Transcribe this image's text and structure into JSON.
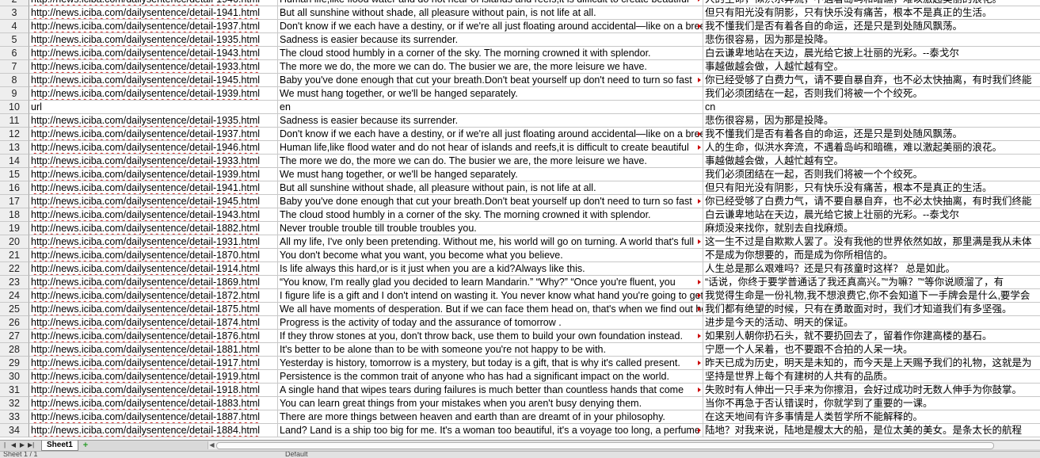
{
  "rows": [
    {
      "num": "2",
      "url": "http://news.iciba.com/dailysentence/detail-1946.html",
      "en": "Human life,like flood water and do not hear of islands and reefs,it is difficult to create beautiful",
      "cn": "人的生命，似洪水奔流，不遇着岛屿和暗礁，难以激起美丽的浪花。"
    },
    {
      "num": "3",
      "url": "http://news.iciba.com/dailysentence/detail-1941.html",
      "en": "But all sunshine without shade, all pleasure without pain, is not life at all.",
      "cn": "但只有阳光没有阴影，只有快乐没有痛苦，根本不是真正的生活。"
    },
    {
      "num": "4",
      "url": "http://news.iciba.com/dailysentence/detail-1937.html",
      "en": "Don't know if we each have a destiny, or if we're all just floating around accidental—like on a breeze",
      "cn": "我不懂我们是否有着各自的命运，还是只是到处随风飘荡。"
    },
    {
      "num": "5",
      "url": "http://news.iciba.com/dailysentence/detail-1935.html",
      "en": "Sadness is easier because its surrender.",
      "cn": "悲伤很容易，因为那是投降。"
    },
    {
      "num": "6",
      "url": "http://news.iciba.com/dailysentence/detail-1943.html",
      "en": "The cloud stood humbly in a corner of the sky. The morning crowned it with splendor.",
      "cn": "白云谦卑地站在天边，晨光给它披上壮丽的光彩。--泰戈尔"
    },
    {
      "num": "7",
      "url": "http://news.iciba.com/dailysentence/detail-1933.html",
      "en": "The more we do, the more we can do. The busier we are, the more leisure we have.",
      "cn": "事越做越会做，人越忙越有空。"
    },
    {
      "num": "8",
      "url": "http://news.iciba.com/dailysentence/detail-1945.html",
      "en": "Baby you've done enough that cut your breath.Don't beat yourself up don't need to turn so fast",
      "cn": "你已经受够了白费力气，请不要自暴自弃，也不必太快抽离，有时我们终能"
    },
    {
      "num": "9",
      "url": "http://news.iciba.com/dailysentence/detail-1939.html",
      "en": " We must hang together, or we'll be hanged separately.",
      "cn": "我们必须团结在一起，否则我们将被一个个绞死。"
    },
    {
      "num": "10",
      "url": "url",
      "en": "en",
      "cn": "cn"
    },
    {
      "num": "11",
      "url": "http://news.iciba.com/dailysentence/detail-1935.html",
      "en": "Sadness is easier because its surrender.",
      "cn": "悲伤很容易，因为那是投降。"
    },
    {
      "num": "12",
      "url": "http://news.iciba.com/dailysentence/detail-1937.html",
      "en": "Don't know if we each have a destiny, or if we're all just floating around accidental—like on a breeze",
      "cn": "我不懂我们是否有着各自的命运，还是只是到处随风飘荡。"
    },
    {
      "num": "13",
      "url": "http://news.iciba.com/dailysentence/detail-1946.html",
      "en": "Human life,like flood water and do not hear of islands and reefs,it is difficult to create beautiful",
      "cn": "人的生命，似洪水奔流，不遇着岛屿和暗礁，难以激起美丽的浪花。"
    },
    {
      "num": "14",
      "url": "http://news.iciba.com/dailysentence/detail-1933.html",
      "en": "The more we do, the more we can do. The busier we are, the more leisure we have.",
      "cn": "事越做越会做，人越忙越有空。"
    },
    {
      "num": "15",
      "url": "http://news.iciba.com/dailysentence/detail-1939.html",
      "en": " We must hang together, or we'll be hanged separately.",
      "cn": "我们必须团结在一起，否则我们将被一个个绞死。"
    },
    {
      "num": "16",
      "url": "http://news.iciba.com/dailysentence/detail-1941.html",
      "en": "But all sunshine without shade, all pleasure without pain, is not life at all.",
      "cn": "但只有阳光没有阴影，只有快乐没有痛苦，根本不是真正的生活。"
    },
    {
      "num": "17",
      "url": "http://news.iciba.com/dailysentence/detail-1945.html",
      "en": "Baby you've done enough that cut your breath.Don't beat yourself up don't need to turn so fast",
      "cn": "你已经受够了白费力气，请不要自暴自弃，也不必太快抽离，有时我们终能"
    },
    {
      "num": "18",
      "url": "http://news.iciba.com/dailysentence/detail-1943.html",
      "en": "The cloud stood humbly in a corner of the sky. The morning crowned it with splendor.",
      "cn": "白云谦卑地站在天边，晨光给它披上壮丽的光彩。--泰戈尔"
    },
    {
      "num": "19",
      "url": "http://news.iciba.com/dailysentence/detail-1882.html",
      "en": " Never trouble trouble till trouble troubles you.",
      "cn": "麻烦没来找你，就别去自找麻烦。"
    },
    {
      "num": "20",
      "url": "http://news.iciba.com/dailysentence/detail-1931.html",
      "en": "All my life, I've only been pretending. Without me, his world will go on turning. A world that's full",
      "cn": "这一生不过是自欺欺人罢了。没有我他的世界依然如故，那里满是我从未体"
    },
    {
      "num": "21",
      "url": "http://news.iciba.com/dailysentence/detail-1870.html",
      "en": "You don't become what you want, you become what you believe.",
      "cn": "不是成为你想要的，而是成为你所相信的。"
    },
    {
      "num": "22",
      "url": "http://news.iciba.com/dailysentence/detail-1914.html",
      "en": "Is life always this hard,or is it just when you are a kid?Always like this.",
      "cn": "人生总是那么艰难吗？还是只有孩童时这样？  总是如此。"
    },
    {
      "num": "23",
      "url": "http://news.iciba.com/dailysentence/detail-1869.html",
      "en": "“You know, I'm really glad you decided to learn Mandarin.” “Why?”   “Once you're fluent, you",
      "cn": "“话说，你终于要学普通话了我还真高兴。”“为嘛？”“等你说顺溜了，有"
    },
    {
      "num": "24",
      "url": "http://news.iciba.com/dailysentence/detail-1872.html",
      "en": "I figure life is a gift and I don't intend on wasting it. You never know what hand you're going to get",
      "cn": "我觉得生命是一份礼物,我不想浪费它,你不会知道下一手牌会是什么,要学会"
    },
    {
      "num": "25",
      "url": "http://news.iciba.com/dailysentence/detail-1875.html",
      "en": "We all have moments of desperation. But if we can face them head on, that's when we find out how",
      "cn": "我们都有绝望的时候，只有在勇敢面对时，我们才知道我们有多坚强。"
    },
    {
      "num": "26",
      "url": "http://news.iciba.com/dailysentence/detail-1874.html",
      "en": "Progress is the activity of today and the assurance of tomorrow .",
      "cn": "进步是今天的活动、明天的保证。"
    },
    {
      "num": "27",
      "url": "http://news.iciba.com/dailysentence/detail-1876.html",
      "en": "If they throw stones at you, don't throw back, use them to build your own foundation instead.",
      "cn": "如果别人朝你扔石头，就不要扔回去了，留着作你建高楼的基石。"
    },
    {
      "num": "28",
      "url": "http://news.iciba.com/dailysentence/detail-1881.html",
      "en": "It's better to be alone than to be with someone you're not happy to be with.",
      "cn": "宁愿一个人呆着，也不要跟不合拍的人呆一块。"
    },
    {
      "num": "29",
      "url": "http://news.iciba.com/dailysentence/detail-1917.html",
      "en": "Yesterday is history, tomorrow is a mystery, but today is a gift, that is why it's called present.",
      "cn": "昨天已成为历史，明天是未知的，而今天是上天赐予我们的礼物，这就是为"
    },
    {
      "num": "30",
      "url": "http://news.iciba.com/dailysentence/detail-1919.html",
      "en": "Persistence is the common trait of anyone who has had a significant impact on the world.",
      "cn": "坚持是世界上每个有建树的人共有的品质。"
    },
    {
      "num": "31",
      "url": "http://news.iciba.com/dailysentence/detail-1918.html",
      "en": "A single hand that wipes tears during failures is much better than countless hands that come",
      "cn": "失败时有人伸出一只手来为你擦泪，会好过成功时无数人伸手为你鼓掌。"
    },
    {
      "num": "32",
      "url": "http://news.iciba.com/dailysentence/detail-1883.html",
      "en": "You can learn great things from your mistakes when you aren't busy denying them.",
      "cn": "当你不再急于否认错误时，你就学到了重要的一课。"
    },
    {
      "num": "33",
      "url": "http://news.iciba.com/dailysentence/detail-1887.html",
      "en": "There are more things between heaven and earth than are dreamt of in your philosophy.",
      "cn": "在这天地间有许多事情是人类哲学所不能解释的。"
    },
    {
      "num": "34",
      "url": "http://news.iciba.com/dailysentence/detail-1884.html",
      "en": "Land? Land is a ship too big for me. It's a woman too beautiful, it's a voyage too long, a perfume",
      "cn": "陆地？对我来说，陆地是艘太大的船，是位太美的美女。是条太长的航程"
    }
  ],
  "overflow_rows": [
    "2",
    "4",
    "8",
    "12",
    "13",
    "17",
    "20",
    "23",
    "24",
    "25",
    "27",
    "29",
    "31",
    "34"
  ],
  "tabs": {
    "sheet_label": "Sheet1",
    "add_label": "+"
  },
  "nav": {
    "first": "|◀",
    "prev": "◀",
    "next": "▶",
    "last": "▶|"
  },
  "status": {
    "sheet_info": "Sheet 1 / 1",
    "style": "Default"
  },
  "colors": {
    "grid": "#c8c8c8",
    "header_bg": "#eeeeee",
    "overflow_marker": "#cc0000"
  }
}
